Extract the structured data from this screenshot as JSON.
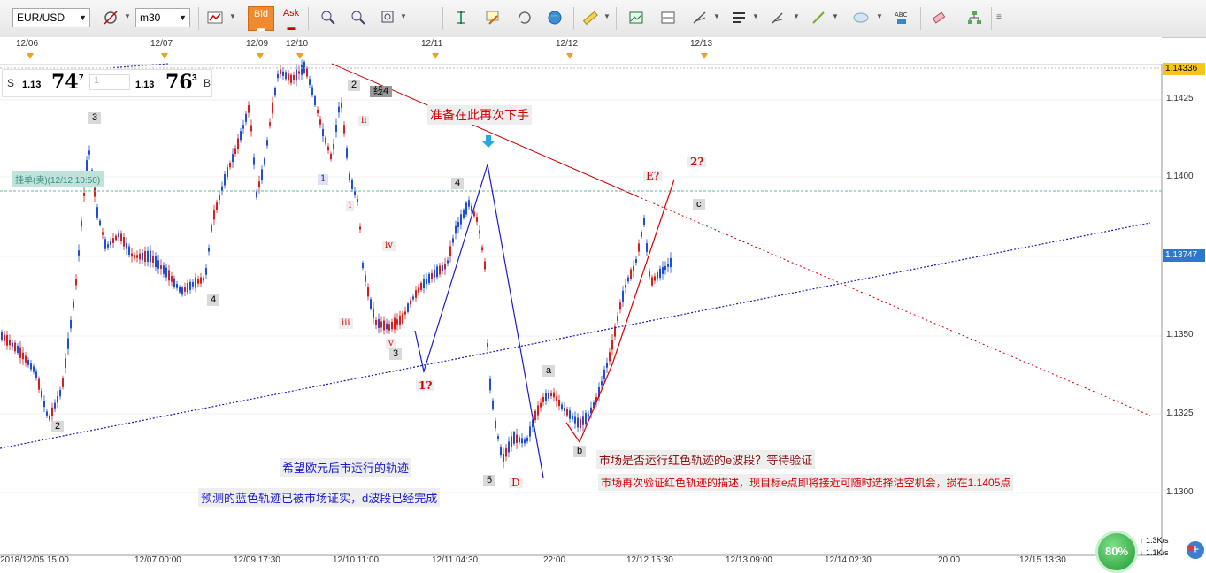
{
  "toolbar": {
    "symbol": "EUR/USD",
    "timeframe": "m30",
    "bid_label": "Bid",
    "ask_label": "Ask",
    "icons": [
      "crosshair-icon",
      "zoom-in-icon",
      "zoom-out-icon",
      "zoom-fit-icon",
      "move-icon",
      "annotate-icon",
      "refresh-icon",
      "globe-icon",
      "ruler-icon",
      "picture-icon",
      "chart-type-icon",
      "fib-icon",
      "lines-icon",
      "pen-icon",
      "trendline-icon",
      "ellipse-icon",
      "text-abc-icon",
      "eraser-icon",
      "tree-icon"
    ]
  },
  "date_bar": {
    "dates": [
      "12/06",
      "12/07",
      "12/09",
      "12/10",
      "12/11",
      "12/12",
      "12/13"
    ]
  },
  "quote": {
    "sell_label": "S",
    "sell_prefix": "1.13",
    "sell_big": "74",
    "sell_sup": "7",
    "lot": "1",
    "buy_prefix": "1.13",
    "buy_big": "76",
    "buy_sup": "3",
    "buy_label": "B"
  },
  "price_axis": {
    "ticks": [
      "1.1425",
      "1.1400",
      "1.1350",
      "1.1325",
      "1.1300"
    ],
    "top_marker": "1.14336",
    "current_marker": "1.13747"
  },
  "time_axis": {
    "ticks": [
      "2018/12/05 15:00",
      "12/07 00:00",
      "12/09 17:30",
      "12/10 11:00",
      "12/11 04:30",
      "22:00",
      "12/12 15:30",
      "12/13 09:00",
      "12/14 02:30",
      "20:00",
      "12/15 13:30"
    ]
  },
  "pending_order": "挂单(卖)(12/12 10:50)",
  "annotations": {
    "retry_here": "准备在此再次下手",
    "hope_path": "希望欧元后市运行的轨迹",
    "blue_confirmed": "预测的蓝色轨迹已被市场证实，d波段已经完成",
    "red_e_question": "市场是否运行红色轨迹的e波段？等待验证",
    "red_verify": "市场再次验证红色轨迹的描述，现目标e点即将接近可随时选择沽空机会，损在1.1405点"
  },
  "wave_labels": {
    "n3a": "3",
    "n2a": "2",
    "n4a": "4",
    "n2b": "2",
    "line4": "线4",
    "ii": "ii",
    "i_blue": "1",
    "i_red": "i",
    "iv": "iv",
    "iii": "iii",
    "v": "v",
    "n3b": "3",
    "n4b": "4",
    "q1": "1?",
    "n5": "5",
    "D": "D",
    "a": "a",
    "b": "b",
    "E": "E?",
    "q2": "2?",
    "c": "c"
  },
  "status": {
    "cpu": "80%",
    "up": "1.3K/s",
    "down": "1.1K/s"
  }
}
